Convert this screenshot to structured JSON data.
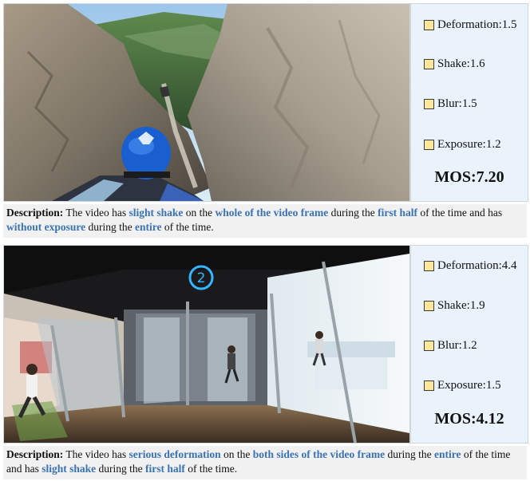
{
  "panels": [
    {
      "scores": {
        "deformation": "Deformation:1.5",
        "shake": "Shake:1.6",
        "blur": "Blur:1.5",
        "exposure": "Exposure:1.2"
      },
      "mos": "MOS:7.20",
      "description": {
        "lead": "Description:",
        "t1": " The video has ",
        "h1": "slight shake",
        "t2": " on the ",
        "h2": "whole of the video frame",
        "t3": " during the ",
        "h3": "first half",
        "t4": " of the time and has ",
        "h4": "without exposure",
        "t5": " during the ",
        "h5": "entire",
        "t6": " of the time."
      }
    },
    {
      "scores": {
        "deformation": "Deformation:4.4",
        "shake": "Shake:1.9",
        "blur": "Blur:1.2",
        "exposure": "Exposure:1.5"
      },
      "mos": "MOS:4.12",
      "sign_number": "2",
      "description": {
        "lead": "Description:",
        "t1": " The video has ",
        "h1": "serious deformation",
        "t2": " on the ",
        "h2": "both sides of the video frame",
        "t3": " during the ",
        "h3": "entire",
        "t4": " of the time and has ",
        "h4": "slight shake",
        "t5": " during the ",
        "h5": "first half",
        "t6": " of the time."
      }
    }
  ]
}
